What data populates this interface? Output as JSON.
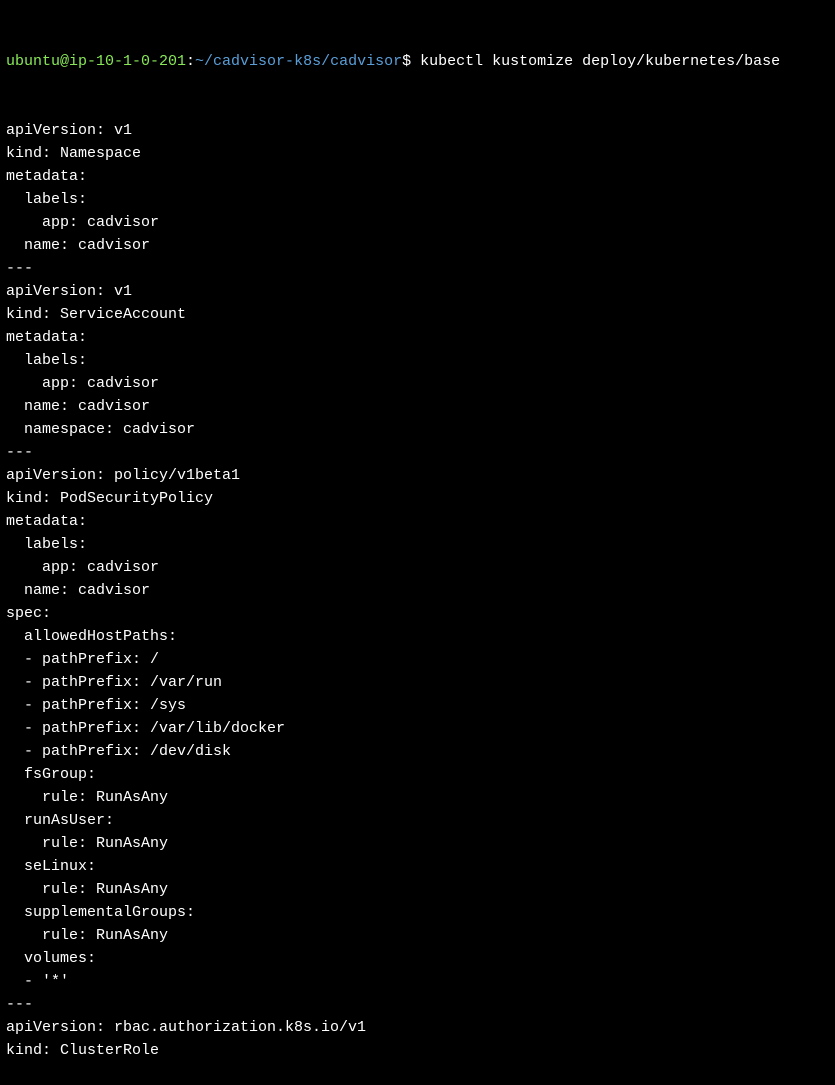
{
  "prompt": {
    "user_host": "ubuntu@ip-10-1-0-201",
    "colon": ":",
    "path": "~/cadvisor-k8s/cadvisor",
    "dollar": "$ ",
    "command": "kubectl kustomize deploy/kubernetes/base"
  },
  "output_lines": [
    "apiVersion: v1",
    "kind: Namespace",
    "metadata:",
    "  labels:",
    "    app: cadvisor",
    "  name: cadvisor",
    "---",
    "apiVersion: v1",
    "kind: ServiceAccount",
    "metadata:",
    "  labels:",
    "    app: cadvisor",
    "  name: cadvisor",
    "  namespace: cadvisor",
    "---",
    "apiVersion: policy/v1beta1",
    "kind: PodSecurityPolicy",
    "metadata:",
    "  labels:",
    "    app: cadvisor",
    "  name: cadvisor",
    "spec:",
    "  allowedHostPaths:",
    "  - pathPrefix: /",
    "  - pathPrefix: /var/run",
    "  - pathPrefix: /sys",
    "  - pathPrefix: /var/lib/docker",
    "  - pathPrefix: /dev/disk",
    "  fsGroup:",
    "    rule: RunAsAny",
    "  runAsUser:",
    "    rule: RunAsAny",
    "  seLinux:",
    "    rule: RunAsAny",
    "  supplementalGroups:",
    "    rule: RunAsAny",
    "  volumes:",
    "  - '*'",
    "---",
    "apiVersion: rbac.authorization.k8s.io/v1",
    "kind: ClusterRole"
  ]
}
